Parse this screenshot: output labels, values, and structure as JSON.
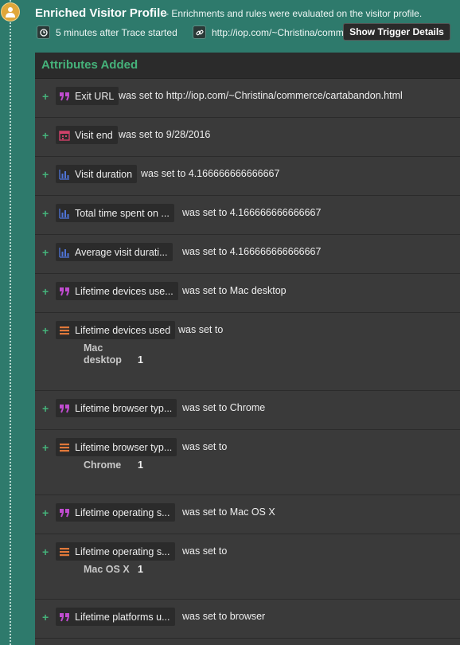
{
  "header": {
    "title": "Enriched Visitor Profile",
    "subtitle": "- Enrichments and rules were evaluated on the visitor profile.",
    "time_text": "5 minutes after Trace started",
    "url_text": "http://iop.com/~Christina/commerce/cartabandon.html",
    "trigger_button": "Show Trigger Details"
  },
  "panel": {
    "title": "Attributes Added",
    "rows": [
      {
        "icon": "quote-icon",
        "name": "Exit URL",
        "phrase": "was set to http://iop.com/~Christina/commerce/cartabandon.html"
      },
      {
        "icon": "calendar-icon",
        "name": "Visit end",
        "phrase": "was set to 9/28/2016"
      },
      {
        "icon": "bar-chart-icon",
        "name": "Visit duration",
        "phrase": "was set to 4.166666666666667"
      },
      {
        "icon": "bar-chart-icon",
        "name": "Total time spent on ...",
        "phrase": "was set to 4.166666666666667"
      },
      {
        "icon": "bar-chart-icon",
        "name": "Average visit durati...",
        "phrase": "was set to 4.166666666666667"
      },
      {
        "icon": "quote-icon",
        "name": "Lifetime devices use...",
        "phrase": "was set to Mac desktop"
      },
      {
        "icon": "list-icon",
        "name": "Lifetime devices used",
        "phrase": "was set to",
        "entries": [
          {
            "key_line1": "Mac",
            "key_line2": "desktop",
            "count": "1"
          }
        ]
      },
      {
        "icon": "quote-icon",
        "name": "Lifetime browser typ...",
        "phrase": "was set to Chrome"
      },
      {
        "icon": "list-icon",
        "name": "Lifetime browser typ...",
        "phrase": "was set to",
        "entries": [
          {
            "key_line1": "Chrome",
            "key_line2": "",
            "count": "1"
          }
        ]
      },
      {
        "icon": "quote-icon",
        "name": "Lifetime operating s...",
        "phrase": "was set to Mac OS X"
      },
      {
        "icon": "list-icon",
        "name": "Lifetime operating s...",
        "phrase": "was set to",
        "entries": [
          {
            "key_line1": "Mac OS X",
            "key_line2": "",
            "count": "1"
          }
        ]
      },
      {
        "icon": "quote-icon",
        "name": "Lifetime platforms u...",
        "phrase": "was set to browser"
      }
    ]
  },
  "colors": {
    "accent_green": "#45b27a",
    "teal_background": "#2e7a6c",
    "quote_icon": "#c04ccf",
    "calendar_icon": "#d0426a",
    "bar_chart_icon": "#4f74d8",
    "list_icon": "#e0783a"
  }
}
